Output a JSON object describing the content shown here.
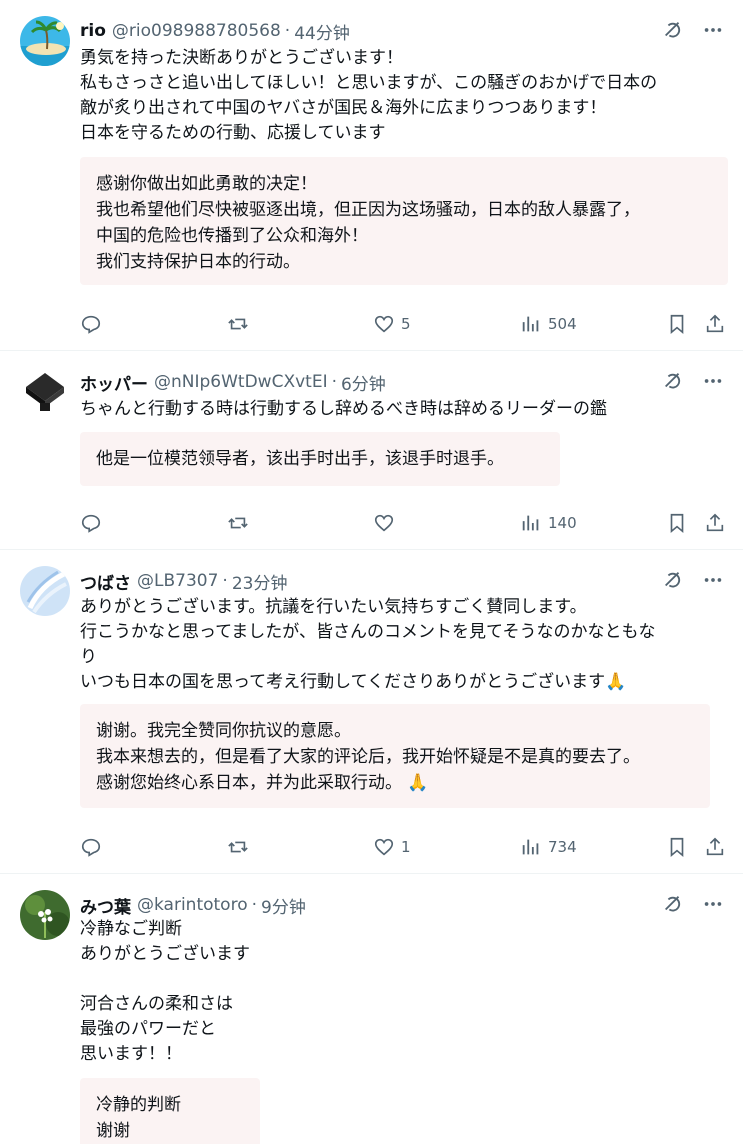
{
  "posts": [
    {
      "name": "rio",
      "handle": "@rio098988780568",
      "time": "44分钟",
      "body": [
        "勇気を持った決断ありがとうございます！",
        "私もさっさと追い出してほしい！と思いますが、この騒ぎのおかげで日本の",
        "敵が炙り出されて中国のヤバさが国民＆海外に広まりつつあります！",
        "日本を守るための行動、応援しています"
      ],
      "translation": [
        "感谢你做出如此勇敢的决定！",
        "我也希望他们尽快被驱逐出境，但正因为这场骚动，日本的敌人暴露了，",
        "中国的危险也传播到了公众和海外！",
        "我们支持保护日本的行动。"
      ],
      "likes": "5",
      "views": "504"
    },
    {
      "name": "ホッパー",
      "handle": "@nNIp6WtDwCXvtEI",
      "time": "6分钟",
      "body": [
        "ちゃんと行動する時は行動するし辞めるべき時は辞めるリーダーの鑑"
      ],
      "translation": [
        "他是一位模范领导者，该出手时出手，该退手时退手。"
      ],
      "likes": "",
      "views": "140"
    },
    {
      "name": "つばさ",
      "handle": "@LB7307",
      "time": "23分钟",
      "body": [
        "ありがとうございます。抗議を行いたい気持ちすごく賛同します。",
        "行こうかなと思ってましたが、皆さんのコメントを見てそうなのかなともな",
        "り",
        "いつも日本の国を思って考え行動してくださりありがとうございます"
      ],
      "body_emoji": "🙏",
      "translation": [
        "谢谢。我完全赞同你抗议的意愿。",
        "我本来想去的，但是看了大家的评论后，我开始怀疑是不是真的要去了。",
        "感谢您始终心系日本，并为此采取行动。"
      ],
      "translation_emoji": "🙏",
      "likes": "1",
      "views": "734"
    },
    {
      "name": "みつ葉",
      "handle": "@karintotoro",
      "time": "9分钟",
      "body": [
        "冷静なご判断",
        "ありがとうございます",
        "",
        "河合さんの柔和さは",
        "最強のパワーだと",
        "思います！！"
      ],
      "translation": [
        "冷静的判断",
        "谢谢"
      ]
    }
  ],
  "icons": {
    "grok": "grok-icon",
    "more": "more-icon",
    "reply": "reply-icon",
    "repost": "repost-icon",
    "like": "like-icon",
    "views": "views-icon",
    "bookmark": "bookmark-icon",
    "share": "share-icon"
  },
  "colors": {
    "text": "#0f1419",
    "muted": "#536471",
    "translation_bg": "#fbf3f3",
    "separator": "#eff3f4"
  }
}
